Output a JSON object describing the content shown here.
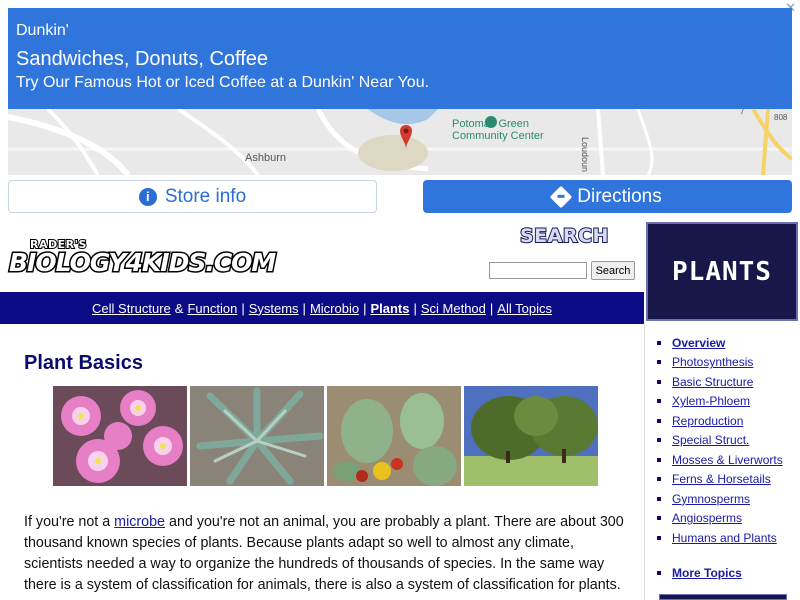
{
  "ad": {
    "close": "✕",
    "brand": "Dunkin'",
    "title": "Sandwiches, Donuts, Coffee",
    "description": "Try Our Famous Hot or Iced Coffee at a Dunkin' Near You.",
    "map_labels": {
      "town": "Ashburn",
      "poi": "Potomac Green\nCommunity Center",
      "road": "Loudoun C",
      "route_808": "808",
      "route_7": "7"
    },
    "store_info_label": "Store info",
    "directions_label": "Directions",
    "colors": {
      "accent": "#2f75dc"
    }
  },
  "site": {
    "logo_small": "RADER'S",
    "logo_main": "BIOLOGY4KIDS.COM",
    "search_heading": "SEARCH",
    "search_placeholder": "",
    "search_button": "Search",
    "section_badge": "PLANTS"
  },
  "nav": {
    "items": [
      {
        "label": "Cell Structure"
      },
      {
        "label": "&",
        "plain": true
      },
      {
        "label": "Function"
      },
      {
        "label": "Systems"
      },
      {
        "label": "Microbio"
      },
      {
        "label": "Plants",
        "current": true
      },
      {
        "label": "Sci Method"
      },
      {
        "label": "All Topics"
      }
    ]
  },
  "main": {
    "title": "Plant Basics",
    "photos": [
      "ice-plant-flowers-photo",
      "aloe-succulent-photo",
      "prickly-pear-cactus-photo",
      "trees-photo"
    ],
    "paragraph": {
      "before_link": "If you're not a ",
      "link": "microbe",
      "after_link": " and you're not an animal, you are probably a plant. There are about 300 thousand known species of plants. Because plants adapt so well to almost any climate, scientists needed a way to organize the hundreds of thousands of species. In the same way there is a system of classification for animals, there is also a system of classification for plants."
    }
  },
  "sidebar": {
    "items": [
      {
        "label": "Overview",
        "current": true
      },
      {
        "label": "Photosynthesis"
      },
      {
        "label": "Basic Structure"
      },
      {
        "label": "Xylem-Phloem"
      },
      {
        "label": "Reproduction"
      },
      {
        "label": "Special Struct."
      },
      {
        "label": "Mosses & Liverworts"
      },
      {
        "label": "Ferns & Horsetails"
      },
      {
        "label": "Gymnosperms"
      },
      {
        "label": "Angiosperms"
      },
      {
        "label": "Humans and Plants"
      }
    ],
    "more_topics": "More Topics"
  }
}
